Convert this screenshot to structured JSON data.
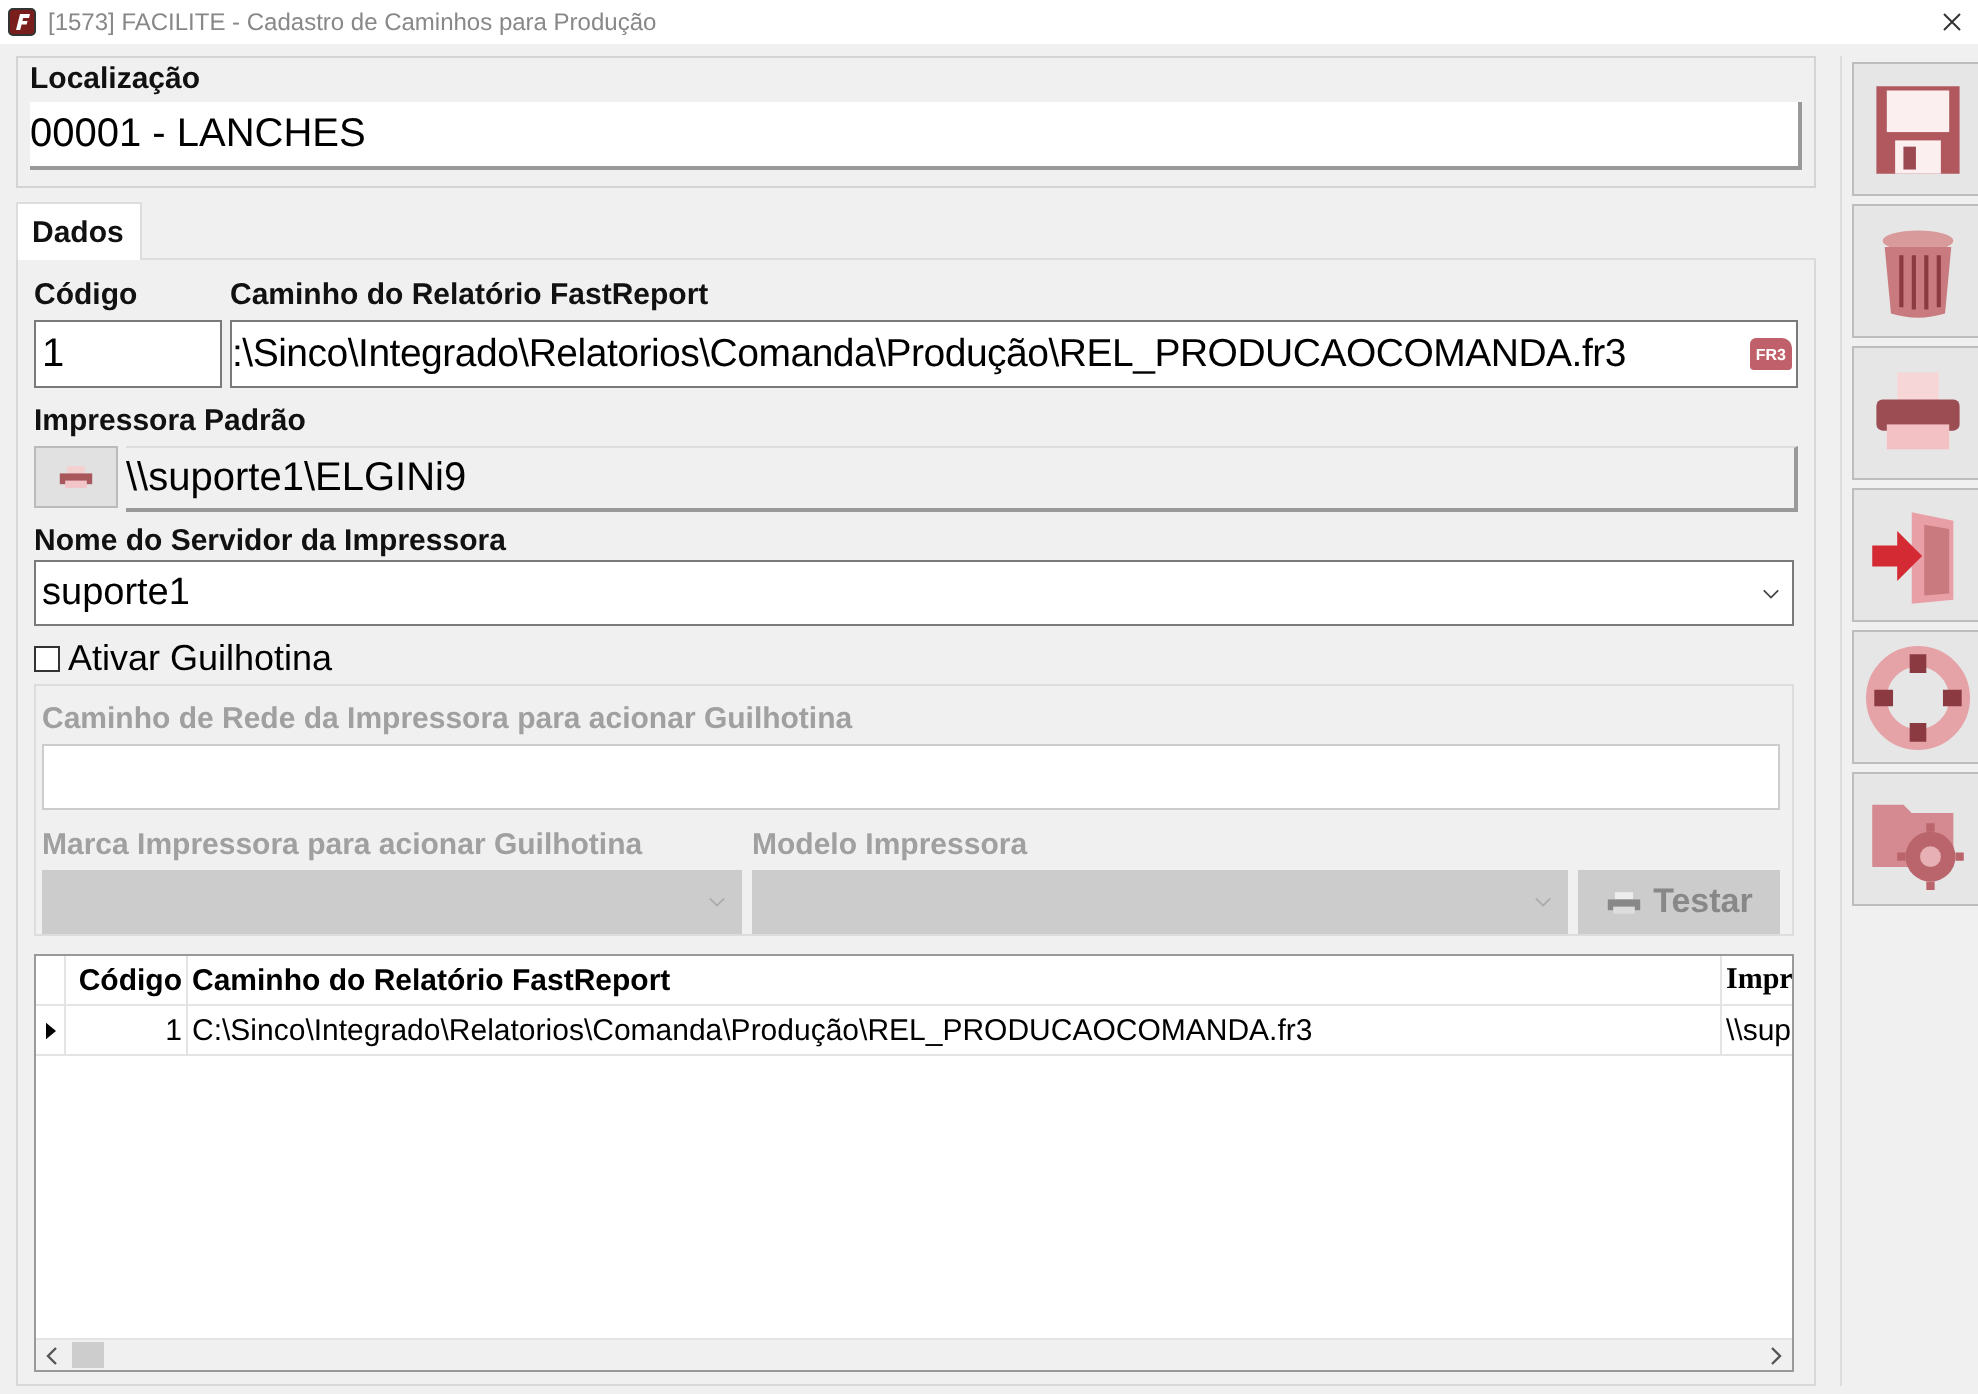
{
  "window": {
    "title": "[1573] FACILITE - Cadastro de Caminhos para Produção"
  },
  "localizacao": {
    "label": "Localização",
    "value": "00001 - LANCHES"
  },
  "tabs": [
    {
      "label": "Dados",
      "selected": true
    }
  ],
  "form": {
    "codigo": {
      "label": "Código",
      "value": "1"
    },
    "caminho": {
      "label": "Caminho do Relatório FastReport",
      "value": ":\\Sinco\\Integrado\\Relatorios\\Comanda\\Produção\\REL_PRODUCAOCOMANDA.fr3",
      "badge": "FR3"
    },
    "impressora": {
      "label": "Impressora Padrão",
      "value": "\\\\suporte1\\ELGINi9"
    },
    "servidor": {
      "label": "Nome do Servidor da Impressora",
      "value": "suporte1"
    },
    "guilhotina": {
      "label": "Ativar Guilhotina",
      "checked": false
    },
    "rede": {
      "label": "Caminho de Rede da Impressora para acionar Guilhotina"
    },
    "marca": {
      "label": "Marca Impressora para acionar Guilhotina"
    },
    "modelo": {
      "label": "Modelo Impressora"
    },
    "testar": {
      "label": "Testar"
    }
  },
  "grid": {
    "columns": [
      "Código",
      "Caminho do Relatório FastReport",
      "Impr"
    ],
    "rows": [
      {
        "cells": [
          "1",
          "C:\\Sinco\\Integrado\\Relatorios\\Comanda\\Produção\\REL_PRODUCAOCOMANDA.fr3",
          "\\\\sup"
        ],
        "selected": true
      }
    ]
  },
  "toolbar": [
    {
      "kind": "save"
    },
    {
      "kind": "delete"
    },
    {
      "kind": "print"
    },
    {
      "kind": "exit"
    },
    {
      "kind": "help"
    },
    {
      "kind": "config"
    }
  ]
}
